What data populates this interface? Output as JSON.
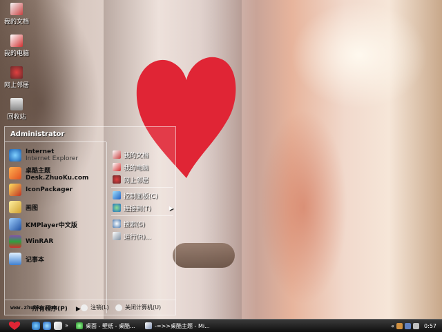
{
  "desktop": {
    "icons": [
      {
        "label": "我的文档",
        "icon": "my-documents-icon"
      },
      {
        "label": "我的电脑",
        "icon": "my-computer-icon"
      },
      {
        "label": "网上邻居",
        "icon": "network-places-icon"
      },
      {
        "label": "回收站",
        "icon": "recycle-bin-icon"
      }
    ],
    "wallpaper_watermark": "www.zhuoku.com"
  },
  "start_menu": {
    "user": "Administrator",
    "left_items": [
      {
        "label": "Internet",
        "sub": "Internet Explorer",
        "icon": "internet-explorer-icon"
      },
      {
        "label": "桌酷主题Desk.ZhuoKu.com",
        "icon": "theme-icon"
      },
      {
        "label": "IconPackager",
        "icon": "iconpackager-icon"
      },
      {
        "label": "画图",
        "icon": "paint-icon"
      },
      {
        "label": "KMPlayer中文版",
        "icon": "kmplayer-icon"
      },
      {
        "label": "WinRAR",
        "icon": "winrar-icon"
      },
      {
        "label": "记事本",
        "icon": "notepad-icon"
      }
    ],
    "all_programs": "所有程序(P)",
    "right_items": [
      {
        "label": "我的文档",
        "icon": "my-documents-icon"
      },
      {
        "label": "我的电脑",
        "icon": "my-computer-icon"
      },
      {
        "label": "网上邻居",
        "icon": "network-places-icon"
      },
      {
        "label": "控制面板(C)",
        "icon": "control-panel-icon"
      },
      {
        "label": "连接到(T)",
        "icon": "connect-icon"
      },
      {
        "label": "搜索(S)",
        "icon": "search-icon"
      },
      {
        "label": "运行(R)...",
        "icon": "run-icon"
      }
    ],
    "footer": {
      "url": "www.zhuoku.com",
      "logoff": "注销(L)",
      "shutdown": "关闭计算机(U)"
    }
  },
  "taskbar": {
    "tasks": [
      {
        "label": "桌面 - 壁纸 - 桌酷...",
        "icon": "browser-icon"
      },
      {
        "label": "-=>>桌酷主题 - Mi...",
        "icon": "window-icon"
      }
    ],
    "clock": "0:57"
  },
  "colors": {
    "heart": "#e02535",
    "taskbar": "#1a1a1a"
  }
}
